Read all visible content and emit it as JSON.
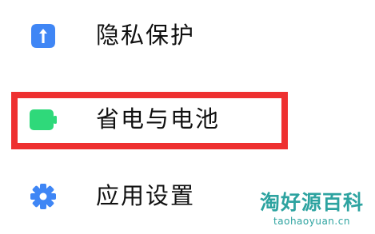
{
  "settings": {
    "items": [
      {
        "label": "隐私保护",
        "icon": "privacy-shield-icon",
        "icon_color": "#3f86f5"
      },
      {
        "label": "省电与电池",
        "icon": "battery-icon",
        "icon_color": "#2fd97a"
      },
      {
        "label": "应用设置",
        "icon": "gear-icon",
        "icon_color": "#3f86f5"
      }
    ]
  },
  "highlight": {
    "color": "#ee3030"
  },
  "watermark": {
    "title": "淘好源百科",
    "url": "taohaoyuan.cn"
  }
}
